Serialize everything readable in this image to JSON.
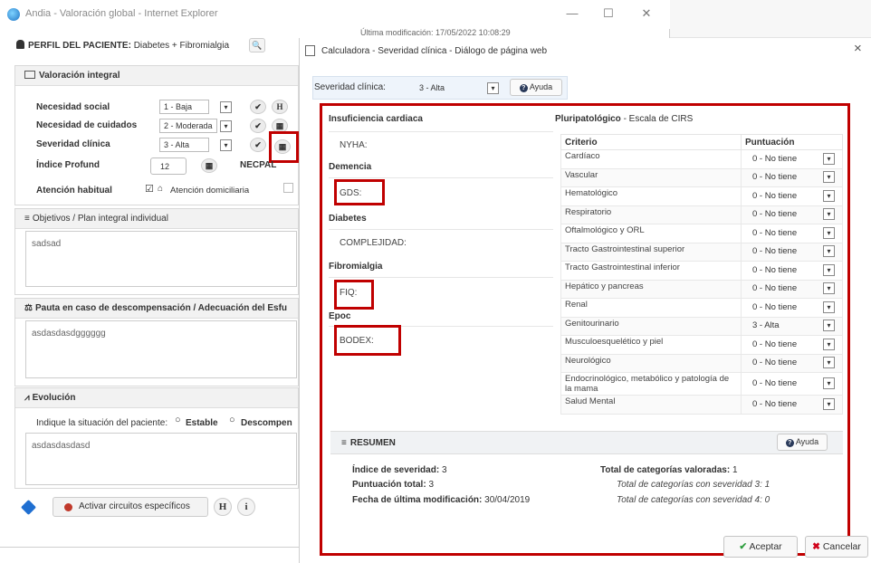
{
  "background_window": {
    "title": "Andia - Valoración global - Internet Explorer",
    "last_modified": "Última modificación: 17/05/2022 10:08:29",
    "controls": {
      "minimize": "—",
      "maximize": "☐",
      "close": "✕"
    },
    "profile_label": "PERFIL DEL PACIENTE:",
    "profile_value": "Diabetes + Fibromialgia",
    "valoracion": {
      "title": "Valoración integral",
      "rows": [
        {
          "label": "Necesidad social",
          "value": "1 - Baja",
          "extra_button": "H"
        },
        {
          "label": "Necesidad de cuidados",
          "value": "2 - Moderada"
        },
        {
          "label": "Severidad clínica",
          "value": "3 - Alta"
        }
      ],
      "indice_label": "Índice Profund",
      "indice_value": "12",
      "necpal_label": "NECPAL",
      "atencion_label": "Atención habitual",
      "atencion_value": "Atención domiciliaria"
    },
    "objetivos": {
      "title": "Objetivos / Plan integral individual",
      "text": "sadsad"
    },
    "pauta": {
      "title": "Pauta en caso de descompensación / Adecuación del Esfu",
      "text": "asdasdasdgggggg"
    },
    "evolucion": {
      "title": "Evolución",
      "prompt": "Indique la situación del paciente:",
      "option_estable": "Estable",
      "option_descompen": "Descompen",
      "text": "asdasdasdasd"
    },
    "footer": {
      "activar_label": "Activar circuitos específicos",
      "h_button": "H",
      "i_button": "i"
    }
  },
  "dialog": {
    "title": "Calculadora - Severidad clínica - Diálogo de página web",
    "close": "×",
    "severidad_label": "Severidad clínica:",
    "severidad_value": "3 - Alta",
    "ayuda_label": "Ayuda",
    "left_sections": [
      {
        "title": "Insuficiencia cardiaca",
        "field": "NYHA:"
      },
      {
        "title": "Demencia",
        "field": "GDS:"
      },
      {
        "title": "Diabetes",
        "field": "COMPLEJIDAD:"
      },
      {
        "title": "Fibromialgia",
        "field": "FIQ:"
      },
      {
        "title": "Epoc",
        "field": "BODEX:"
      }
    ],
    "pluripatologico_title": "Pluripatológico",
    "pluripatologico_subtitle": "- Escala de CIRS",
    "table": {
      "headers": [
        "Criterio",
        "Puntuación"
      ],
      "rows": [
        {
          "criterio": "Cardíaco",
          "puntuacion": "0 - No tiene"
        },
        {
          "criterio": "Vascular",
          "puntuacion": "0 - No tiene"
        },
        {
          "criterio": "Hematológico",
          "puntuacion": "0 - No tiene"
        },
        {
          "criterio": "Respiratorio",
          "puntuacion": "0 - No tiene"
        },
        {
          "criterio": "Oftalmológico y ORL",
          "puntuacion": "0 - No tiene"
        },
        {
          "criterio": "Tracto Gastrointestinal superior",
          "puntuacion": "0 - No tiene"
        },
        {
          "criterio": "Tracto Gastrointestinal inferior",
          "puntuacion": "0 - No tiene"
        },
        {
          "criterio": "Hepático y pancreas",
          "puntuacion": "0 - No tiene"
        },
        {
          "criterio": "Renal",
          "puntuacion": "0 - No tiene"
        },
        {
          "criterio": "Genitourinario",
          "puntuacion": "3 - Alta"
        },
        {
          "criterio": "Musculoesquelético y piel",
          "puntuacion": "0 - No tiene"
        },
        {
          "criterio": "Neurológico",
          "puntuacion": "0 - No tiene"
        },
        {
          "criterio": "Endocrinológico, metabólico y patología de la mama",
          "puntuacion": "0 - No tiene"
        },
        {
          "criterio": "Salud Mental",
          "puntuacion": "0 - No tiene"
        }
      ]
    },
    "resumen": {
      "title": "RESUMEN",
      "ayuda_label": "Ayuda",
      "indice_label": "Índice de severidad:",
      "indice_value": "3",
      "puntuacion_label": "Puntuación total:",
      "puntuacion_value": "3",
      "fecha_label": "Fecha de última modificación:",
      "fecha_value": "30/04/2019",
      "total_label": "Total de categorías valoradas:",
      "total_value": "1",
      "sev3": "Total de categorías con severidad 3: 1",
      "sev4": "Total de categorías con severidad 4: 0"
    },
    "aceptar_label": "Aceptar",
    "cancelar_label": "Cancelar"
  },
  "colors": {
    "highlight": "#c00000",
    "accent_blue": "#1f6fd1",
    "ok_green": "#2e9e3e",
    "cancel_red": "#d0021b"
  }
}
